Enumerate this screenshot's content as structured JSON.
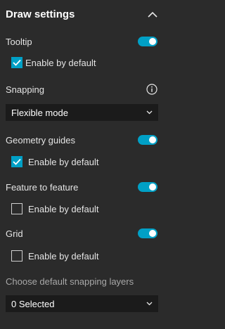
{
  "panel": {
    "title": "Draw settings"
  },
  "tooltip": {
    "label": "Tooltip",
    "toggle_on": true,
    "checkbox_label": "Enable by default",
    "checkbox_checked": true
  },
  "snapping": {
    "label": "Snapping",
    "mode_selected": "Flexible mode"
  },
  "geometry_guides": {
    "label": "Geometry guides",
    "toggle_on": true,
    "checkbox_label": "Enable by default",
    "checkbox_checked": true
  },
  "feature_to_feature": {
    "label": "Feature to feature",
    "toggle_on": true,
    "checkbox_label": "Enable by default",
    "checkbox_checked": false
  },
  "grid": {
    "label": "Grid",
    "toggle_on": true,
    "checkbox_label": "Enable by default",
    "checkbox_checked": false
  },
  "snapping_layers": {
    "label": "Choose default snapping layers",
    "selected_text": "0 Selected"
  },
  "colors": {
    "background": "#2b2b2b",
    "accent": "#00a0c6",
    "select_background": "#1b1b1b"
  }
}
